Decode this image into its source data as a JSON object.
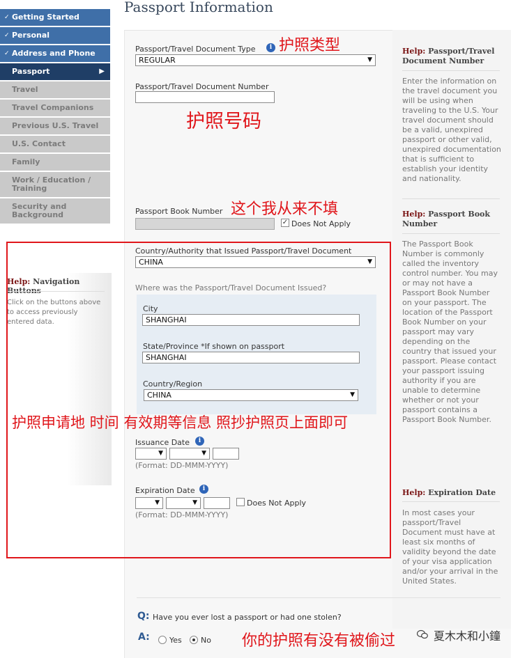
{
  "page": {
    "title": "Passport Information"
  },
  "nav": {
    "items": [
      {
        "label": "Getting Started",
        "state": "done"
      },
      {
        "label": "Personal",
        "state": "done"
      },
      {
        "label": "Address and Phone",
        "state": "done"
      },
      {
        "label": "Passport",
        "state": "current"
      },
      {
        "label": "Travel",
        "state": "todo"
      },
      {
        "label": "Travel Companions",
        "state": "todo"
      },
      {
        "label": "Previous U.S. Travel",
        "state": "todo"
      },
      {
        "label": "U.S. Contact",
        "state": "todo"
      },
      {
        "label": "Family",
        "state": "todo"
      },
      {
        "label": "Work / Education / Training",
        "state": "todo"
      },
      {
        "label": "Security and Background",
        "state": "todo"
      }
    ]
  },
  "left_help": {
    "prefix": "Help:",
    "title": "Navigation Buttons",
    "body": "Click on the buttons above to access previously entered data."
  },
  "form": {
    "doc_type": {
      "label": "Passport/Travel Document Type",
      "value": "REGULAR"
    },
    "doc_number": {
      "label": "Passport/Travel Document Number",
      "value": ""
    },
    "book_number": {
      "label": "Passport Book Number",
      "value": "",
      "na_label": "Does Not Apply",
      "na_checked": true
    },
    "issuing_country": {
      "label": "Country/Authority that Issued Passport/Travel Document",
      "value": "CHINA"
    },
    "issued_where": {
      "label": "Where was the Passport/Travel Document Issued?",
      "city": {
        "label": "City",
        "value": "SHANGHAI"
      },
      "state": {
        "label": "State/Province *If shown on passport",
        "value": "SHANGHAI"
      },
      "country": {
        "label": "Country/Region",
        "value": "CHINA"
      }
    },
    "issuance_date": {
      "label": "Issuance Date",
      "format": "(Format: DD-MMM-YYYY)"
    },
    "expiration_date": {
      "label": "Expiration Date",
      "format": "(Format: DD-MMM-YYYY)",
      "na_label": "Does Not Apply",
      "na_checked": false
    },
    "lost_question": {
      "q_prefix": "Q:",
      "question": "Have you ever lost a passport or had one stolen?",
      "a_prefix": "A:",
      "yes_label": "Yes",
      "no_label": "No",
      "selected": "No"
    }
  },
  "help": {
    "prefix": "Help:",
    "doc": {
      "title": "Passport/Travel Document Number",
      "body": "Enter the information on the travel document you will be using when traveling to the U.S. Your travel document should be a valid, unexpired passport or other valid, unexpired documentation that is sufficient to establish your identity and nationality."
    },
    "book": {
      "title": "Passport Book Number",
      "body": "The Passport Book Number is commonly called the inventory control number. You may or may not have a Passport Book Number on your passport. The location of the Passport Book Number on your passport may vary depending on the country that issued your passport. Please contact your passport issuing authority if you are unable to determine whether or not your passport contains a Passport Book Number."
    },
    "expiration": {
      "title": "Expiration Date",
      "body": "In most cases your passport/Travel Document must have at least six months of validity beyond the date of your visa application and/or your arrival in the United States."
    }
  },
  "annotations": {
    "passport_type": "护照类型",
    "passport_number": "护照号码",
    "never_fill": "这个我从来不填",
    "issue_info": "护照申请地  时间  有效期等信息  照抄护照页上面即可",
    "lost_stolen": "你的护照有没有被偷过"
  },
  "watermark": {
    "text": "夏木木和小鐘"
  },
  "colors": {
    "nav_done": "#3f6fa8",
    "nav_current": "#1f3e66",
    "nav_todo": "#c9c9c9",
    "annotation": "#e0161b",
    "help_accent": "#7a1414"
  }
}
